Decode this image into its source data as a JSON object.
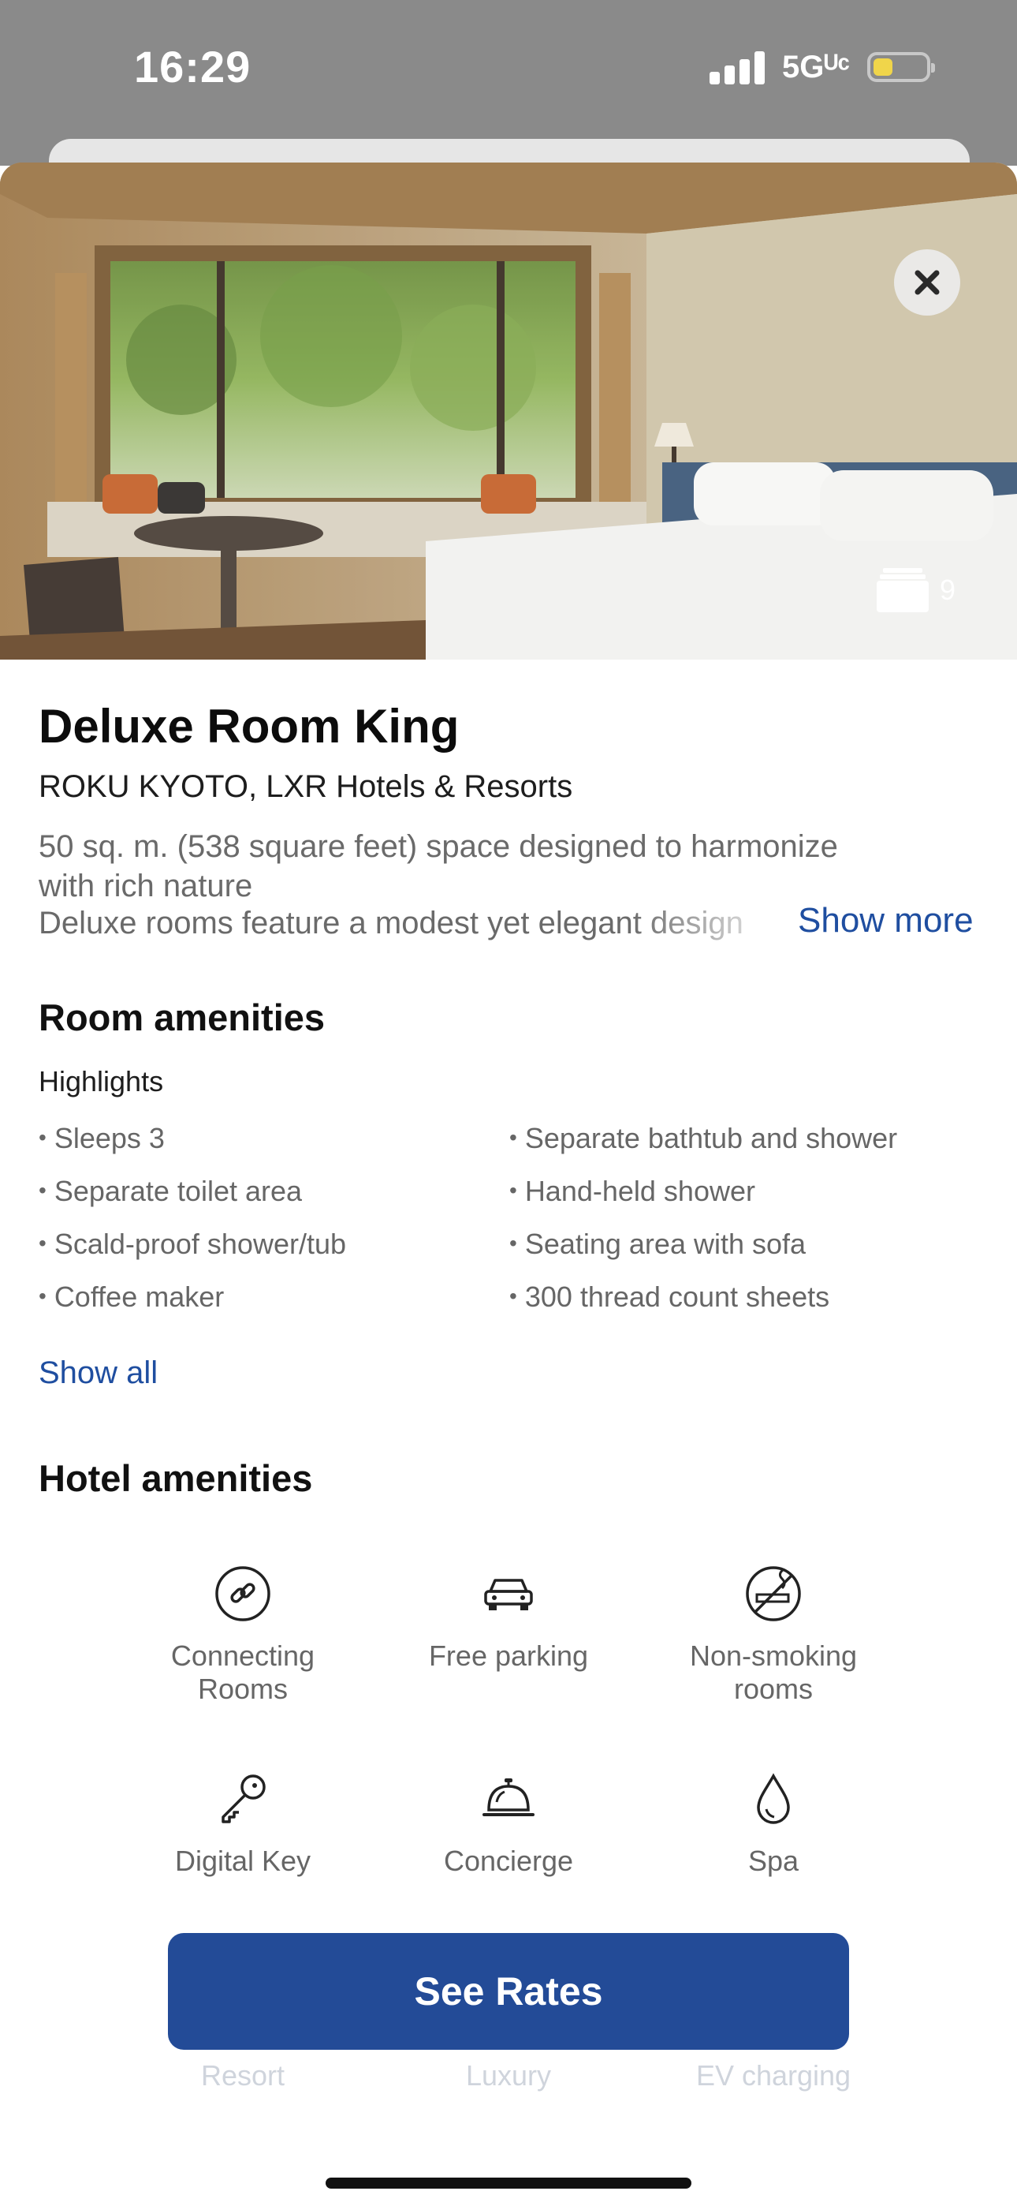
{
  "status_bar": {
    "time": "16:29",
    "network": "5Gᵁᶜ",
    "battery_level": 0.3
  },
  "hero": {
    "photo_count": "9",
    "accent_colors": {
      "wood": "#a57a45",
      "wall": "#cbbf9f",
      "foliage": "#7fa24a",
      "bed": "#f2f2f0"
    }
  },
  "room": {
    "title": "Deluxe Room King",
    "hotel": "ROKU KYOTO, LXR Hotels & Resorts",
    "description_line1": "50 sq. m. (538 square feet) space designed to harmonize",
    "description_line2": "with rich nature",
    "description_line3": "Deluxe rooms feature a modest yet elegant design",
    "show_more": "Show more"
  },
  "room_amenities": {
    "heading": "Room amenities",
    "subheading": "Highlights",
    "left": [
      "Sleeps 3",
      "Separate toilet area",
      "Scald-proof shower/tub",
      "Coffee maker"
    ],
    "right": [
      "Separate bathtub and shower",
      "Hand-held shower",
      "Seating area with sofa",
      "300 thread count sheets"
    ],
    "show_all": "Show all"
  },
  "hotel_amenities": {
    "heading": "Hotel amenities",
    "items": [
      {
        "icon": "link-icon",
        "label_line1": "Connecting",
        "label_line2": "Rooms"
      },
      {
        "icon": "car-icon",
        "label_line1": "Free parking",
        "label_line2": ""
      },
      {
        "icon": "no-smoking-icon",
        "label_line1": "Non-smoking",
        "label_line2": "rooms"
      },
      {
        "icon": "key-icon",
        "label_line1": "Digital Key",
        "label_line2": ""
      },
      {
        "icon": "bell-icon",
        "label_line1": "Concierge",
        "label_line2": ""
      },
      {
        "icon": "drop-icon",
        "label_line1": "Spa",
        "label_line2": ""
      }
    ],
    "faded": [
      "Resort",
      "Luxury",
      "EV charging"
    ]
  },
  "cta": {
    "label": "See Rates",
    "color": "#234b97"
  },
  "link_color": "#1f4ea0"
}
